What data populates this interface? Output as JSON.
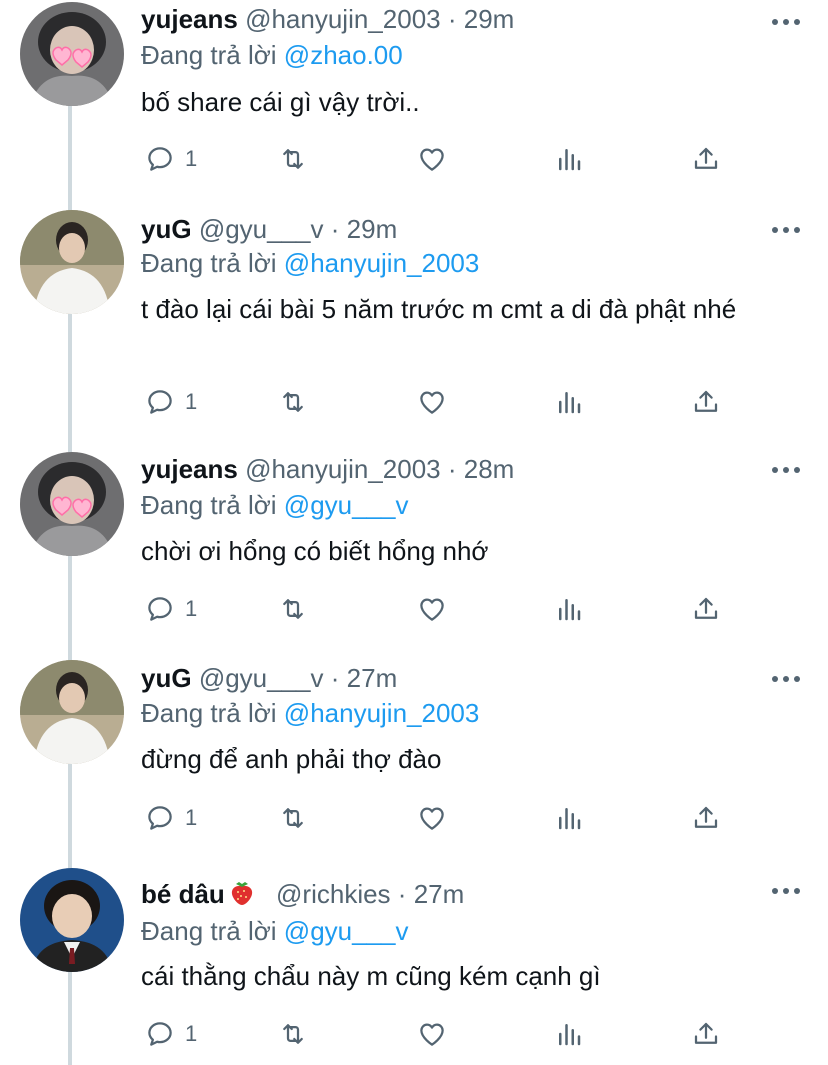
{
  "colors": {
    "accent": "#1d9bf0",
    "secondary_text": "#536471",
    "thread_line": "#cfd9de"
  },
  "tweets": [
    {
      "name": "yujeans",
      "handle": "@hanyujin_2003",
      "dot": "·",
      "time": "29m",
      "replying_prefix": "Đang trả lời",
      "replying_to": "@zhao.00",
      "text": "bố share cái gì vậy trời..",
      "reply_count": "1",
      "avatar": "avatar-yujeans"
    },
    {
      "name": "yuG",
      "handle": "@gyu___v",
      "dot": "·",
      "time": "29m",
      "replying_prefix": "Đang trả lời",
      "replying_to": "@hanyujin_2003",
      "text": "t đào lại cái bài 5 năm trước m cmt a di đà phật nhé",
      "reply_count": "1",
      "avatar": "avatar-yug"
    },
    {
      "name": "yujeans",
      "handle": "@hanyujin_2003",
      "dot": "·",
      "time": "28m",
      "replying_prefix": "Đang trả lời",
      "replying_to": "@gyu___v",
      "text": "chời ơi hổng có biết hổng nhớ",
      "reply_count": "1",
      "avatar": "avatar-yujeans"
    },
    {
      "name": "yuG",
      "handle": "@gyu___v",
      "dot": "·",
      "time": "27m",
      "replying_prefix": "Đang trả lời",
      "replying_to": "@hanyujin_2003",
      "text": "đừng để anh phải thợ đào",
      "reply_count": "1",
      "avatar": "avatar-yug"
    },
    {
      "name": "bé dâu",
      "name_emoji": "strawberry-icon",
      "handle": "@richkies",
      "dot": "·",
      "time": "27m",
      "replying_prefix": "Đang trả lời",
      "replying_to": "@gyu___v",
      "text": "cái thằng chẩu này m cũng kém cạnh gì",
      "reply_count": "1",
      "avatar": "avatar-bedau"
    }
  ],
  "icons": [
    "reply-icon",
    "retweet-icon",
    "like-icon",
    "analytics-icon",
    "share-icon",
    "more-icon"
  ]
}
